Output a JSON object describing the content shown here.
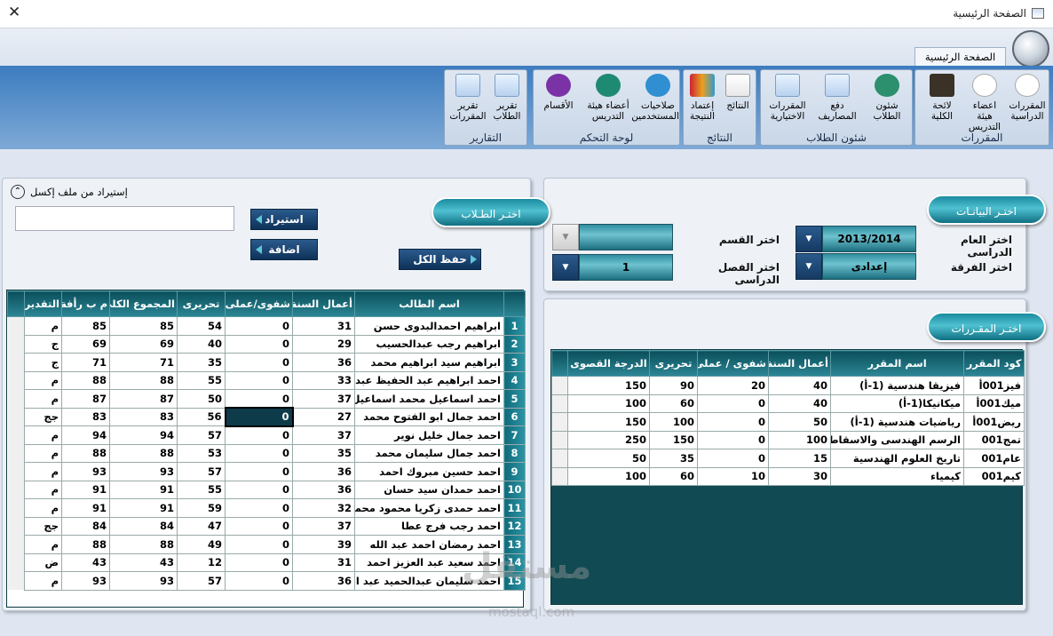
{
  "window": {
    "title": "الصفحة الرئيسية"
  },
  "ribbon": {
    "tab": "الصفحة الرئيسية",
    "groups": [
      {
        "title": "المقررات",
        "buttons": [
          "المقررات الدراسية",
          "اعضاء هيئة التدريس",
          "لائحة الكلية"
        ]
      },
      {
        "title": "شئون الطلاب",
        "buttons": [
          "شئون الطلاب",
          "دفع المصاريف",
          "المقررات الاختيارية"
        ]
      },
      {
        "title": "النتائج",
        "buttons": [
          "النتائج",
          "إعتماد النتيجة"
        ]
      },
      {
        "title": "لوحة التحكم",
        "buttons": [
          "صلاحيات المستخدمين",
          "أعضاء هيئة التدريس",
          "الأقسام"
        ]
      },
      {
        "title": "التقارير",
        "buttons": [
          "تقرير الطلاب",
          "تقرير المقررات"
        ]
      }
    ]
  },
  "right_panel": {
    "pill": "اختـر البيانـات",
    "year_label": "اختر العام الدراسى",
    "year_value": "2013/2014",
    "dept_label": "اختر القسم",
    "dept_value": "",
    "grade_label": "اختر الفرقة",
    "grade_value": "إعدادى",
    "semester_label": "اختر الفصل الدراسى",
    "semester_value": "1"
  },
  "courses_panel": {
    "pill": "اختـر المقـررات",
    "columns": [
      "كود المقرر",
      "اسم المقرر",
      "أعمال السنة",
      "شفوى / عملى",
      "تحريرى",
      "الدرجة القصوى"
    ],
    "rows": [
      [
        "فيز001أ",
        "فيزيقا هندسية (1-أ)",
        "40",
        "20",
        "90",
        "150"
      ],
      [
        "ميك001أ",
        "ميكانيكا(1-أ)",
        "40",
        "0",
        "60",
        "100"
      ],
      [
        "ريض001أ",
        "رياضيات هندسية (1-أ)",
        "50",
        "0",
        "100",
        "150"
      ],
      [
        "تمج001",
        "الرسم الهندسى والاسقاط**",
        "100",
        "0",
        "150",
        "250"
      ],
      [
        "عام001",
        "تاريخ العلوم الهندسية",
        "15",
        "0",
        "35",
        "50"
      ],
      [
        "كيم001",
        "كيمياء",
        "30",
        "10",
        "60",
        "100"
      ]
    ]
  },
  "students_panel": {
    "pill": "اختـر الطـلاب",
    "import_toggle": "إستيراد من ملف إكسل",
    "import_button": "استيراد",
    "add_button": "اضافة",
    "save_all_button": "حفظ الكل",
    "import_path": "",
    "columns": [
      "اسم الطالب",
      "أعمال السنة",
      "شفوى/عملى",
      "تحريرى",
      "المجموع الكلى",
      "م ب رأفة",
      "التقدير"
    ],
    "rows": [
      [
        "1",
        "ابراهيم احمدالبدوى حسن",
        "31",
        "0",
        "54",
        "85",
        "85",
        "م"
      ],
      [
        "2",
        "ابراهيم رجب عبدالحسيب",
        "29",
        "0",
        "40",
        "69",
        "69",
        "ج"
      ],
      [
        "3",
        "ابراهيم سيد ابراهيم محمد",
        "36",
        "0",
        "35",
        "71",
        "71",
        "ج"
      ],
      [
        "4",
        "احمد ابراهيم عبد الحفيظ عبدال",
        "33",
        "0",
        "55",
        "88",
        "88",
        "م"
      ],
      [
        "5",
        "احمد اسماعيل محمد اسماعيل",
        "37",
        "0",
        "50",
        "87",
        "87",
        "م"
      ],
      [
        "6",
        "احمد جمال ابو الفتوح محمد",
        "27",
        "0",
        "56",
        "83",
        "83",
        "جج"
      ],
      [
        "7",
        "احمد جمال خليل نوير",
        "37",
        "0",
        "57",
        "94",
        "94",
        "م"
      ],
      [
        "8",
        "احمد جمال سليمان محمد",
        "35",
        "0",
        "53",
        "88",
        "88",
        "م"
      ],
      [
        "9",
        "احمد حسين مبروك احمد",
        "36",
        "0",
        "57",
        "93",
        "93",
        "م"
      ],
      [
        "10",
        "احمد حمدان سيد حسان",
        "36",
        "0",
        "55",
        "91",
        "91",
        "م"
      ],
      [
        "11",
        "احمد حمدى زكريا محمود محمد",
        "32",
        "0",
        "59",
        "91",
        "91",
        "م"
      ],
      [
        "12",
        "احمد رجب فرج عطا",
        "37",
        "0",
        "47",
        "84",
        "84",
        "جج"
      ],
      [
        "13",
        "احمد رمضان احمد عبد الله",
        "39",
        "0",
        "49",
        "88",
        "88",
        "م"
      ],
      [
        "14",
        "احمد سعيد عبد العزيز احمد",
        "31",
        "0",
        "12",
        "43",
        "43",
        "ض"
      ],
      [
        "15",
        "احمد سليمان عبدالحميد عبد ال",
        "36",
        "0",
        "57",
        "93",
        "93",
        "م"
      ]
    ]
  },
  "watermark": {
    "logo": "مستقل",
    "url": "mostaql.com"
  }
}
